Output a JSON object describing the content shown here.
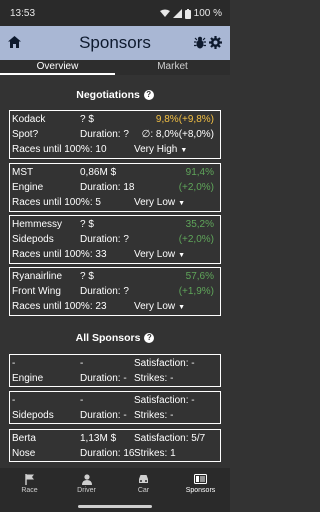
{
  "status": {
    "time": "13:53",
    "battery": "100 %"
  },
  "app_bar": {
    "title": "Sponsors"
  },
  "tabs": {
    "overview": "Overview",
    "market": "Market"
  },
  "negotiations": {
    "title": "Negotiations",
    "help": "?",
    "items": [
      {
        "name": "Kodack",
        "amount": "? $",
        "slot": "Spot?",
        "duration": "Duration: ?",
        "chance": "9,8%(+9,8%)",
        "chance2": "∅: 8,0%(+8,0%)",
        "races": "Races until 100%: 10",
        "priority": "Very High"
      },
      {
        "name": "MST",
        "amount": "0,86M $",
        "slot": "Engine",
        "duration": "Duration: 18",
        "chance": "91,4%",
        "chance2": "(+2,0%)",
        "races": "Races until 100%: 5",
        "priority": "Very Low"
      },
      {
        "name": "Hemmessy",
        "amount": "? $",
        "slot": "Sidepods",
        "duration": "Duration: ?",
        "chance": "35,2%",
        "chance2": "(+2,0%)",
        "races": "Races until 100%: 33",
        "priority": "Very Low"
      },
      {
        "name": "Ryanairline",
        "amount": "? $",
        "slot": "Front Wing",
        "duration": "Duration: ?",
        "chance": "57,6%",
        "chance2": "(+1,9%)",
        "races": "Races until 100%: 23",
        "priority": "Very Low"
      }
    ]
  },
  "all_sponsors": {
    "title": "All Sponsors",
    "help": "?",
    "items": [
      {
        "name": "-",
        "amount": "-",
        "satisfaction": "Satisfaction: -",
        "slot": "Engine",
        "duration": "Duration: -",
        "strikes": "Strikes: -"
      },
      {
        "name": "-",
        "amount": "-",
        "satisfaction": "Satisfaction: -",
        "slot": "Sidepods",
        "duration": "Duration: -",
        "strikes": "Strikes: -"
      },
      {
        "name": "Berta",
        "amount": "1,13M $",
        "satisfaction": "Satisfaction: 5/7",
        "slot": "Nose",
        "duration": "Duration: 16",
        "strikes": "Strikes: 1"
      }
    ]
  },
  "nav": {
    "race": "Race",
    "driver": "Driver",
    "car": "Car",
    "sponsors": "Sponsors"
  },
  "colors": {
    "app_bar": "#a9b7d4",
    "background": "#333333",
    "positive": "#5fa55a",
    "warning": "#f3c044"
  },
  "icons": [
    "home-icon",
    "bug-icon",
    "gear-icon",
    "flag-icon",
    "person-icon",
    "car-icon",
    "sponsor-icon",
    "wifi-icon",
    "signal-icon",
    "battery-icon"
  ]
}
